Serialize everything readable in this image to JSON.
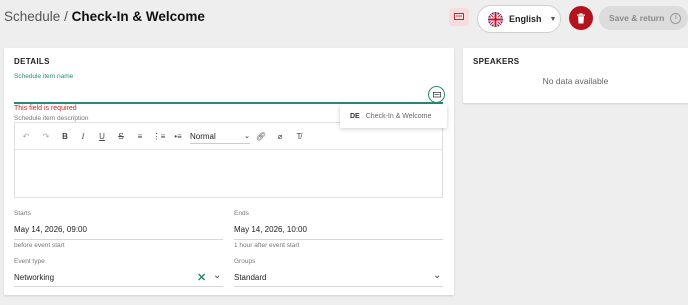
{
  "header": {
    "breadcrumb_root": "Schedule",
    "breadcrumb_sep": "/",
    "breadcrumb_current": "Check-In & Welcome",
    "language": "English",
    "save_label": "Save & return"
  },
  "details": {
    "title": "DETAILS",
    "name_label": "Schedule item name",
    "name_value": "",
    "name_error": "This field is required",
    "description_label": "Schedule item description",
    "toolbar_format": "Normal",
    "translation_lang": "DE",
    "translation_value": "Check-In & Welcome",
    "starts_label": "Starts",
    "starts_value": "May 14, 2026, 09:00",
    "starts_hint": "before event start",
    "ends_label": "Ends",
    "ends_value": "May 14, 2026, 10:00",
    "ends_hint": "1 hour after event start",
    "event_type_label": "Event type",
    "event_type_value": "Networking",
    "groups_label": "Groups",
    "groups_value": "Standard"
  },
  "speakers": {
    "title": "SPEAKERS",
    "empty": "No data available"
  },
  "colors": {
    "accent": "#2a8a78",
    "danger": "#b3141b",
    "error": "#c62828"
  }
}
